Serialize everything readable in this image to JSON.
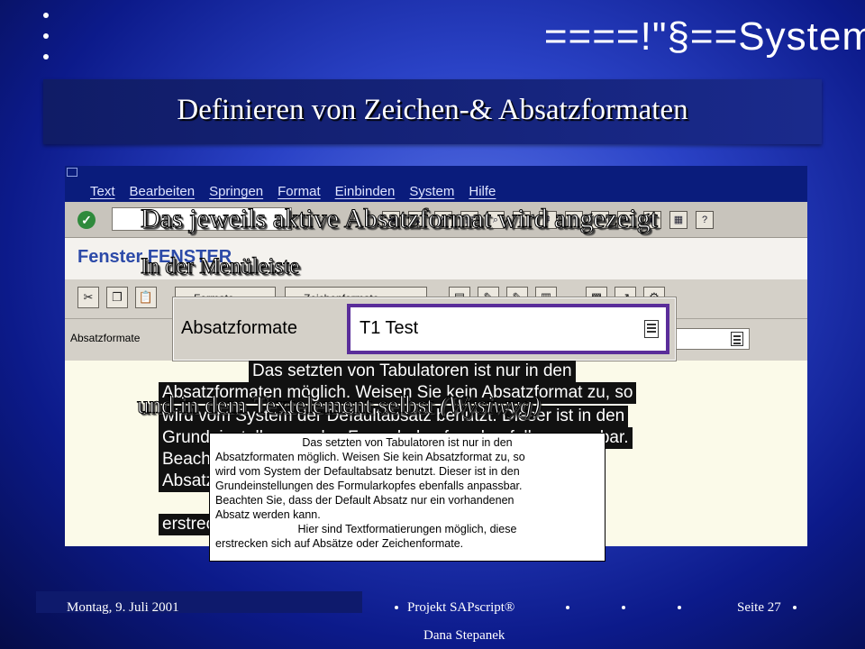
{
  "header": {
    "logo_text": "====!\"§==System"
  },
  "slide": {
    "title": "Definieren von Zeichen-& Absatzformaten",
    "captions": {
      "active_format": "Das jeweils aktive Absatzformat wird angezeigt",
      "menubar": "In der Menüleiste",
      "in_element": "und in dem Textelement  selbst",
      "wysiwyg": "(Wysiwyg)"
    }
  },
  "sap": {
    "menu": [
      "Text",
      "Bearbeiten",
      "Springen",
      "Format",
      "Einbinden",
      "System",
      "Hilfe"
    ],
    "window_title": "Fenster FENSTER",
    "buttons": {
      "formats": "Formate",
      "char_formats": "Zeichenformate"
    },
    "paragraph_formats_label": "Absatzformate",
    "callout": {
      "label": "Absatzformate",
      "value": "T1 Test"
    }
  },
  "zoom_text": [
    "Das setzten von Tabulatoren ist nur in den",
    "Absatzformaten möglich. Weisen Sie kein Absatzformat zu, so",
    "wird vom System der Defaultabsatz benutzt. Dieser ist in den",
    "Grundeinstellungen des Formularkopfes ebenfalls anpassbar.",
    "Beachten",
    "Absatz",
    "erstrec"
  ],
  "popup_text": [
    "Das setzten von Tabulatoren ist nur in den",
    "Absatzformaten möglich. Weisen Sie kein Absatzformat zu, so",
    "wird vom System der Defaultabsatz benutzt. Dieser ist in den",
    "Grundeinstellungen des Formularkopfes ebenfalls anpassbar.",
    "Beachten Sie, dass der Default Absatz nur ein vorhandenen",
    "Absatz werden kann.",
    "Hier sind Textformatierungen möglich, diese",
    "erstrecken sich auf Absätze oder Zeichenformate."
  ],
  "footer": {
    "date": "Montag, 9. Juli 2001",
    "project": "Projekt SAPscript®",
    "page": "Seite 27",
    "author": "Dana Stepanek"
  }
}
